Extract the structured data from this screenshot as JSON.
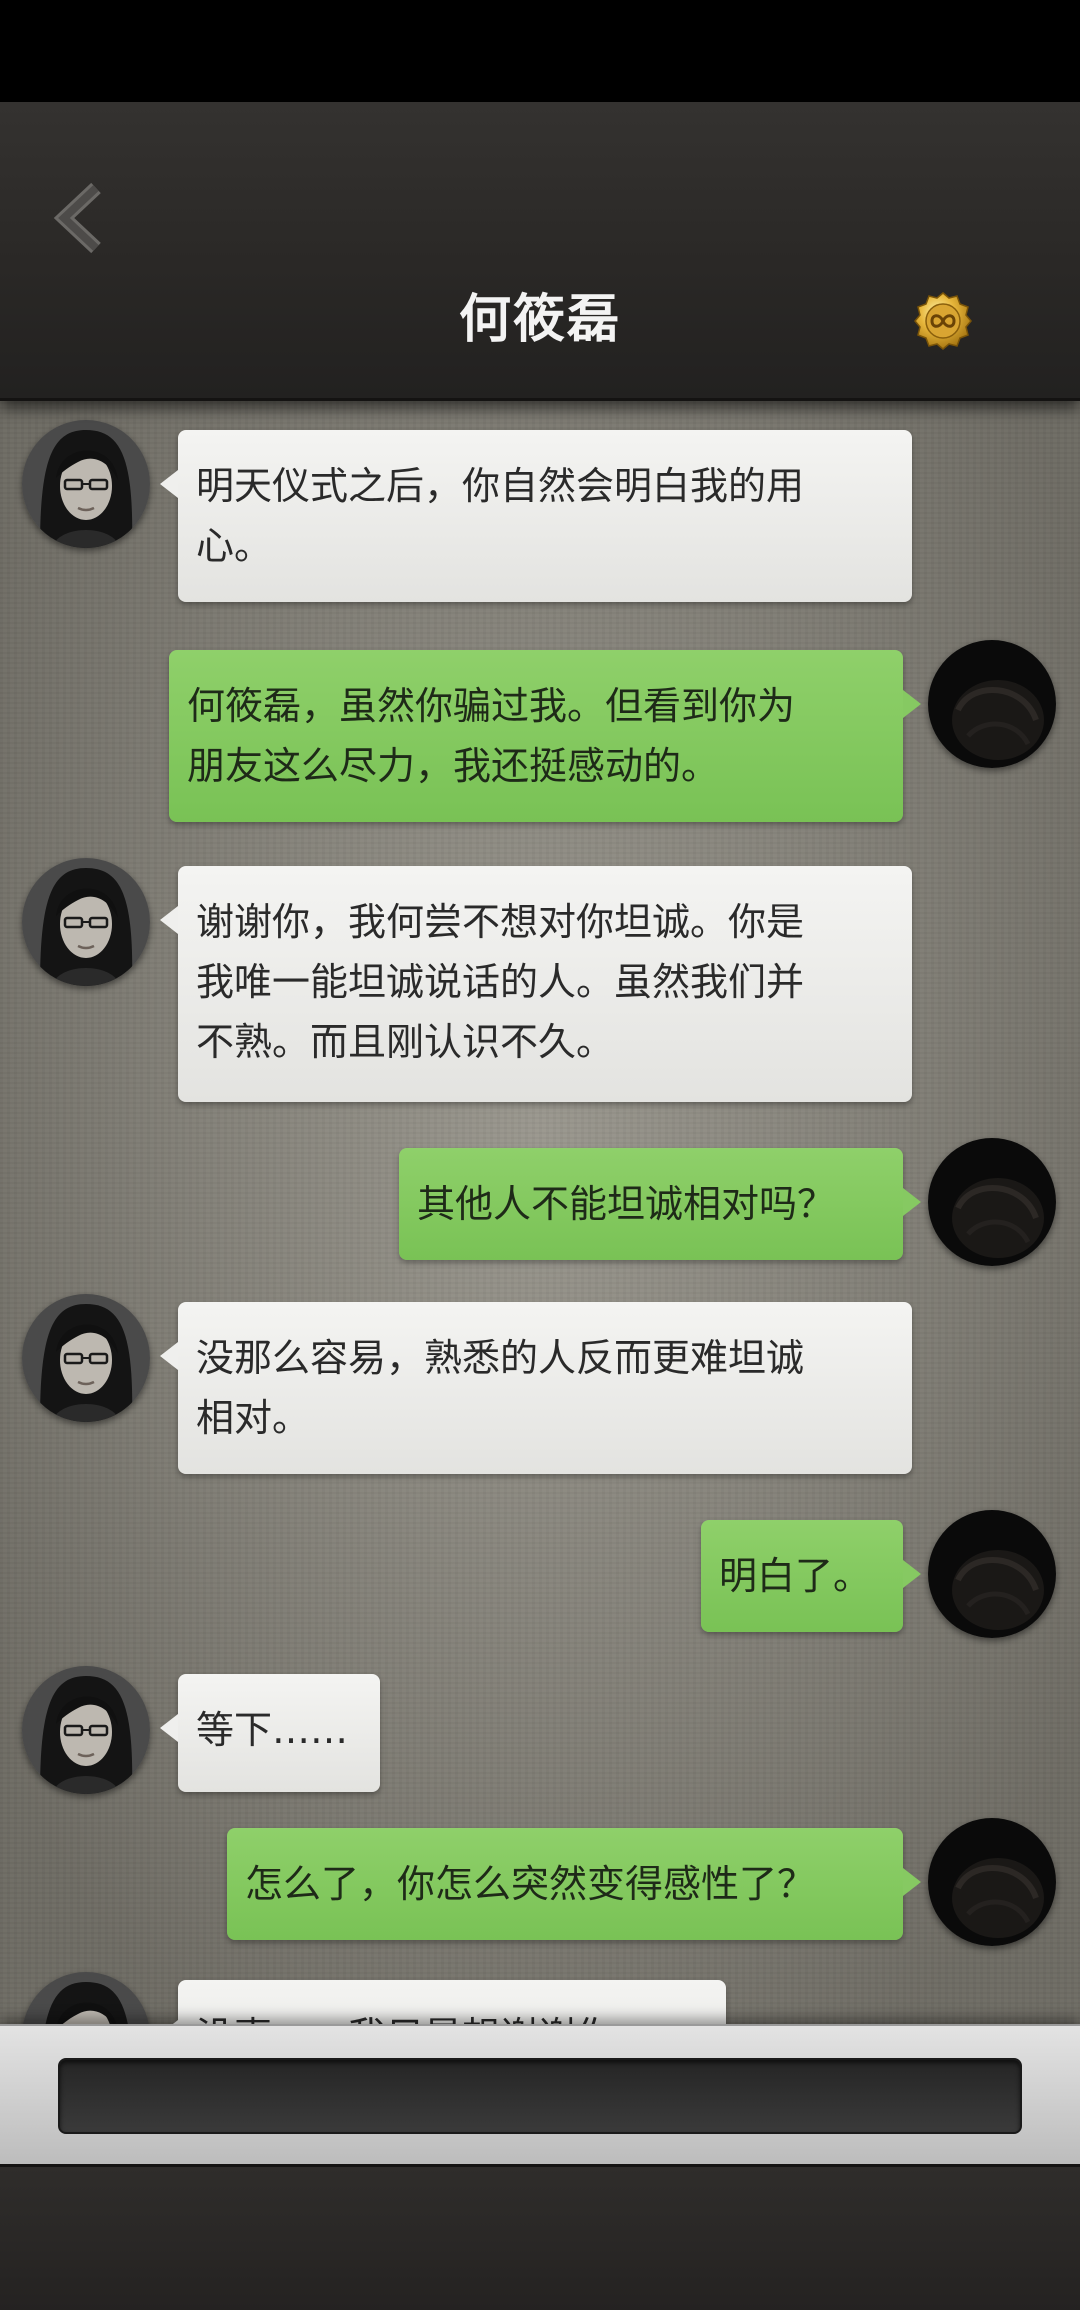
{
  "header": {
    "title": "何筱磊"
  },
  "icons": {
    "back": "chevron-left-icon",
    "coin": "infinity-coin-icon"
  },
  "messages": [
    {
      "side": "in",
      "text": "明天仪式之后，你自然会明白我的用\n心。"
    },
    {
      "side": "out",
      "text": "何筱磊，虽然你骗过我。但看到你为\n朋友这么尽力，我还挺感动的。"
    },
    {
      "side": "in",
      "text": "谢谢你，我何尝不想对你坦诚。你是\n我唯一能坦诚说话的人。虽然我们并\n不熟。而且刚认识不久。"
    },
    {
      "side": "out",
      "text": "其他人不能坦诚相对吗？"
    },
    {
      "side": "in",
      "text": "没那么容易，熟悉的人反而更难坦诚\n相对。"
    },
    {
      "side": "out",
      "text": "明白了。"
    },
    {
      "side": "in",
      "text": "等下……"
    },
    {
      "side": "out",
      "text": "怎么了，你怎么突然变得感性了？"
    },
    {
      "side": "in",
      "text": "没事……我只是想谢谢你……"
    }
  ],
  "input": {
    "value": "",
    "placeholder": ""
  }
}
